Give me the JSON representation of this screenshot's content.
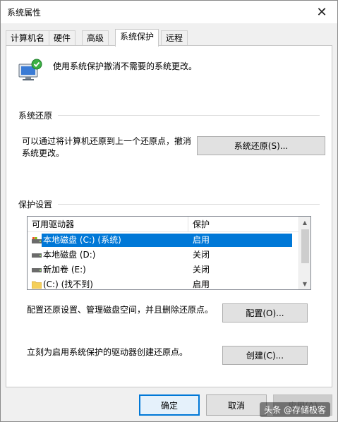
{
  "window": {
    "title": "系统属性",
    "close_glyph": "✕"
  },
  "tabs": [
    {
      "label": "计算机名",
      "active": false
    },
    {
      "label": "硬件",
      "active": false
    },
    {
      "label": "高级",
      "active": false
    },
    {
      "label": "系统保护",
      "active": true
    },
    {
      "label": "远程",
      "active": false
    }
  ],
  "intro": {
    "text": "使用系统保护撤消不需要的系统更改。",
    "icon": "system-protection-icon"
  },
  "restore": {
    "group_label": "系统还原",
    "description_line1": "可以通过将计算机还原到上一个还原点，撤消",
    "description_line2": "系统更改。",
    "button_label": "系统还原(S)..."
  },
  "protection": {
    "group_label": "保护设置",
    "columns": [
      "可用驱动器",
      "保护"
    ],
    "drives": [
      {
        "name": "本地磁盘 (C:) (系统)",
        "status": "启用",
        "icon": "system-drive-icon",
        "selected": true
      },
      {
        "name": "本地磁盘 (D:)",
        "status": "关闭",
        "icon": "hard-drive-icon",
        "selected": false
      },
      {
        "name": "新加卷 (E:)",
        "status": "关闭",
        "icon": "hard-drive-icon",
        "selected": false
      },
      {
        "name": "(C:) (找不到)",
        "status": "启用",
        "icon": "folder-icon",
        "selected": false
      }
    ],
    "configure_text": "配置还原设置、管理磁盘空间，并且删除还原点。",
    "configure_button": "配置(O)...",
    "create_text": "立刻为启用系统保护的驱动器创建还原点。",
    "create_button": "创建(C)..."
  },
  "footer": {
    "ok": "确定",
    "cancel": "取消",
    "apply": "应用(A)"
  },
  "watermark": "头条 @存储极客",
  "colors": {
    "selection": "#0078d7",
    "accent": "#0078d7"
  }
}
